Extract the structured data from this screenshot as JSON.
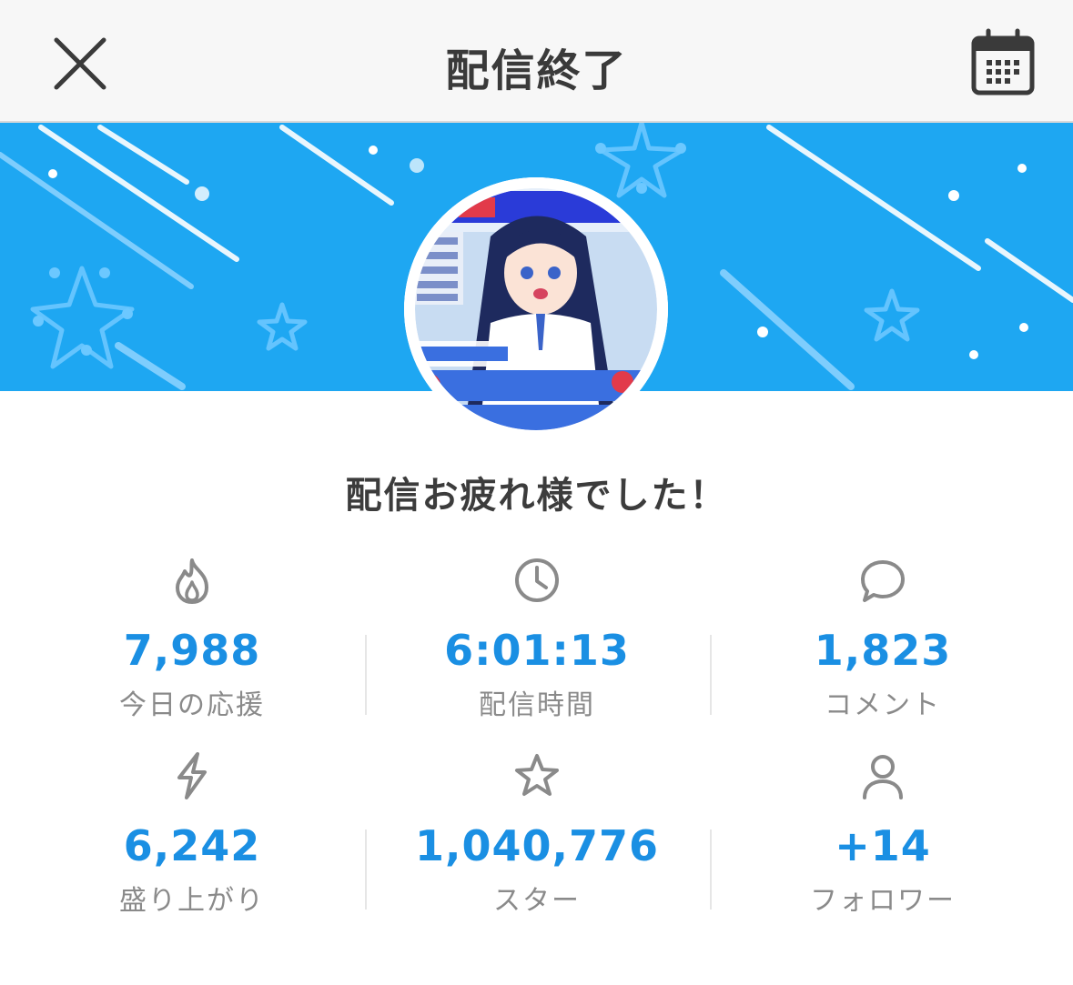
{
  "header": {
    "title": "配信終了",
    "close_icon": "close-icon",
    "calendar_icon": "calendar-icon"
  },
  "banner": {
    "background_color": "#1ea7f2",
    "avatar_description_icon": "stream-thumbnail"
  },
  "message": "配信お疲れ様でした！",
  "stats": [
    {
      "icon": "flame-icon",
      "value": "7,988",
      "label": "今日の応援"
    },
    {
      "icon": "clock-icon",
      "value": "6:01:13",
      "label": "配信時間"
    },
    {
      "icon": "comment-icon",
      "value": "1,823",
      "label": "コメント"
    },
    {
      "icon": "lightning-icon",
      "value": "6,242",
      "label": "盛り上がり"
    },
    {
      "icon": "star-icon",
      "value": "1,040,776",
      "label": "スター"
    },
    {
      "icon": "person-icon",
      "value": "+14",
      "label": "フォロワー"
    }
  ],
  "colors": {
    "accent": "#1a8fe3",
    "label": "#8a8a8a",
    "header_bg": "#f7f7f7"
  }
}
